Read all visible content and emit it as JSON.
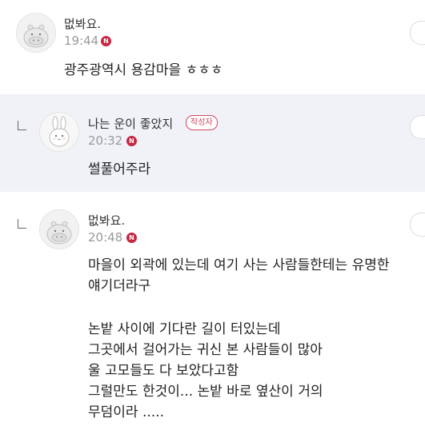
{
  "comments": [
    {
      "nickname": "멊봐요.",
      "time": "19:44",
      "new_badge": "N",
      "lines": [
        "광주광역시 용감마을 ㅎㅎㅎ"
      ]
    },
    {
      "nickname": "나는 운이 좋았지",
      "author_badge": "작성자",
      "time": "20:32",
      "new_badge": "N",
      "lines": [
        "썰풀어주라"
      ]
    },
    {
      "nickname": "멊봐요.",
      "time": "20:48",
      "new_badge": "N",
      "lines": [
        "마을이 외곽에 있는데 여기 사는 사람들한테는 유명한",
        "얘기더라구",
        "",
        "논밭 사이에 기다란 길이 터있는데",
        "그곳에서 걸어가는 귀신 본 사람들이 많아",
        "울 고모들도 다 보았다고함",
        "그럴만도 한것이... 논밭 바로 옆산이 거의",
        "무덤이라 ....."
      ]
    }
  ],
  "colors": {
    "reply_background": "#f0f2f8",
    "new_badge": "#c6263f",
    "author_badge": "#d7475e"
  }
}
